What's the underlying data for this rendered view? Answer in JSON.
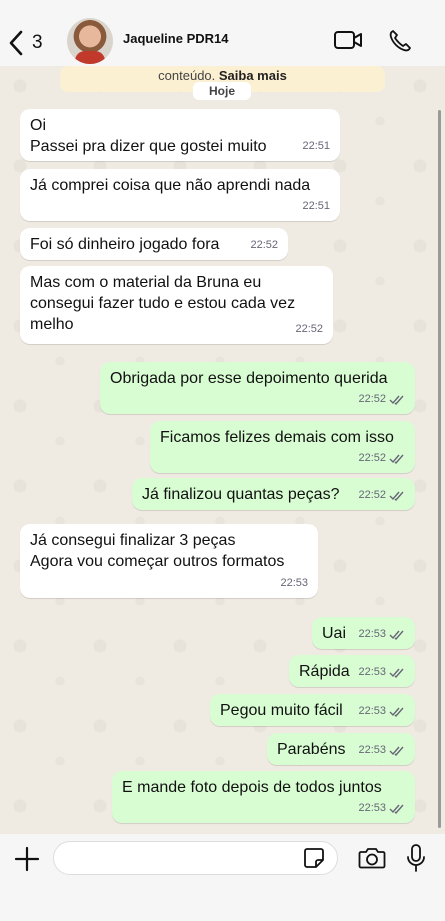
{
  "header": {
    "back_count": "3",
    "contact_name": "Jaqueline PDR14"
  },
  "chat": {
    "notice_text": "conteúdo.",
    "notice_link": "Saiba mais",
    "day_label": "Hoje",
    "messages": [
      {
        "dir": "in",
        "text": "Oi\nPassei pra dizer que gostei muito",
        "time": "22:51"
      },
      {
        "dir": "in",
        "text": "Já comprei coisa que não aprendi nada",
        "time": "22:51"
      },
      {
        "dir": "in",
        "text": "Foi só dinheiro jogado fora",
        "time": "22:52"
      },
      {
        "dir": "in",
        "text": "Mas com o material da Bruna eu\nconsegui fazer tudo e estou cada vez\nmelho",
        "time": "22:52"
      },
      {
        "dir": "out",
        "text": "Obrigada por esse depoimento querida",
        "time": "22:52"
      },
      {
        "dir": "out",
        "text": "Ficamos felizes demais com isso",
        "time": "22:52"
      },
      {
        "dir": "out",
        "text": "Já finalizou quantas peças?",
        "time": "22:52"
      },
      {
        "dir": "in",
        "text": "Já consegui finalizar 3 peças\nAgora vou começar outros formatos",
        "time": "22:53"
      },
      {
        "dir": "out",
        "text": "Uai",
        "time": "22:53"
      },
      {
        "dir": "out",
        "text": "Rápida",
        "time": "22:53"
      },
      {
        "dir": "out",
        "text": "Pegou muito fácil",
        "time": "22:53"
      },
      {
        "dir": "out",
        "text": "Parabéns",
        "time": "22:53"
      },
      {
        "dir": "out",
        "text": "E mande foto depois de todos juntos",
        "time": "22:53"
      }
    ]
  },
  "footer": {
    "message_placeholder": ""
  },
  "colors": {
    "outgoing_bubble": "#d9fdd3",
    "incoming_bubble": "#ffffff",
    "chat_background": "#efeae2",
    "read_tick": "#53bdeb"
  },
  "icons": [
    "chevron-left-icon",
    "video-camera-icon",
    "phone-icon",
    "plus-icon",
    "sticker-icon",
    "camera-icon",
    "microphone-icon",
    "double-check-icon"
  ]
}
